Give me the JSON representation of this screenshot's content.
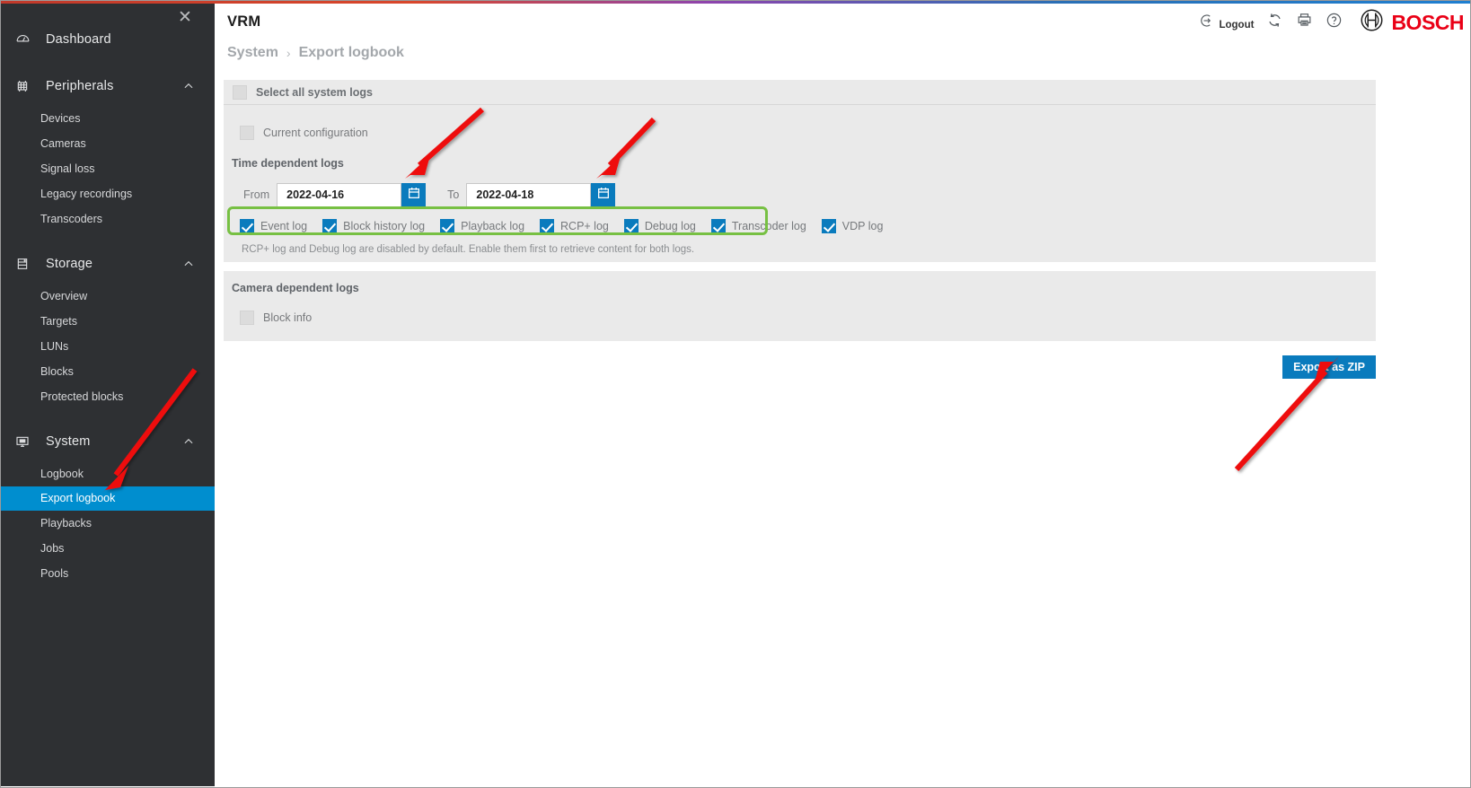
{
  "window": {
    "close_label": "✕"
  },
  "header": {
    "app_title": "VRM",
    "logout_label": "Logout",
    "logout_icon": "logout-icon",
    "refresh_icon": "refresh-icon",
    "print_icon": "print-icon",
    "help_icon": "help-icon",
    "brand": "BOSCH",
    "brand_color": "#ea0016",
    "brand_logo_icon": "bosch-logo-icon"
  },
  "breadcrumb": {
    "parent": "System",
    "separator": "›",
    "current": "Export logbook"
  },
  "sidebar": {
    "background": "#2e3033",
    "active_color": "#008ecf",
    "groups": [
      {
        "label": "Dashboard",
        "icon": "dashboard-icon",
        "expandable": false,
        "items": []
      },
      {
        "label": "Peripherals",
        "icon": "peripherals-icon",
        "expandable": true,
        "chevron": "chevron-up-icon",
        "items": [
          {
            "label": "Devices",
            "active": false
          },
          {
            "label": "Cameras",
            "active": false
          },
          {
            "label": "Signal loss",
            "active": false
          },
          {
            "label": "Legacy recordings",
            "active": false
          },
          {
            "label": "Transcoders",
            "active": false
          }
        ]
      },
      {
        "label": "Storage",
        "icon": "storage-icon",
        "expandable": true,
        "chevron": "chevron-up-icon",
        "items": [
          {
            "label": "Overview",
            "active": false
          },
          {
            "label": "Targets",
            "active": false
          },
          {
            "label": "LUNs",
            "active": false
          },
          {
            "label": "Blocks",
            "active": false
          },
          {
            "label": "Protected blocks",
            "active": false
          }
        ]
      },
      {
        "label": "System",
        "icon": "system-icon",
        "expandable": true,
        "chevron": "chevron-up-icon",
        "items": [
          {
            "label": "Logbook",
            "active": false
          },
          {
            "label": "Export logbook",
            "active": true
          },
          {
            "label": "Playbacks",
            "active": false
          },
          {
            "label": "Jobs",
            "active": false
          },
          {
            "label": "Pools",
            "active": false
          }
        ]
      }
    ]
  },
  "main": {
    "system_logs": {
      "select_all_label": "Select all system logs",
      "select_all_checked": false,
      "current_configuration_label": "Current configuration",
      "current_configuration_checked": false,
      "time_dependent_label": "Time dependent logs",
      "from_label": "From",
      "from_value": "2022-04-16",
      "to_label": "To",
      "to_value": "2022-04-18",
      "calendar_icon": "calendar-icon",
      "log_types": [
        {
          "label": "Event log",
          "checked": true
        },
        {
          "label": "Block history log",
          "checked": true
        },
        {
          "label": "Playback log",
          "checked": true
        },
        {
          "label": "RCP+ log",
          "checked": true
        },
        {
          "label": "Debug log",
          "checked": true
        },
        {
          "label": "Transcoder log",
          "checked": true
        },
        {
          "label": "VDP log",
          "checked": true
        }
      ],
      "hint": "RCP+ log and Debug log are disabled by default. Enable them first to retrieve content for both logs."
    },
    "camera_logs": {
      "title": "Camera dependent logs",
      "block_info_label": "Block info",
      "block_info_checked": false
    },
    "export_button_label": "Export as ZIP"
  },
  "annotations": {
    "arrow_color": "#ee1111",
    "highlight_color": "#77c043",
    "arrows": [
      {
        "name": "arrow-to-sidebar-export-logbook"
      },
      {
        "name": "arrow-to-from-calendar-button"
      },
      {
        "name": "arrow-to-to-calendar-button"
      },
      {
        "name": "arrow-to-export-as-zip-button"
      }
    ],
    "highlight_boxes": [
      {
        "name": "highlight-log-type-checkbox-row"
      }
    ]
  }
}
